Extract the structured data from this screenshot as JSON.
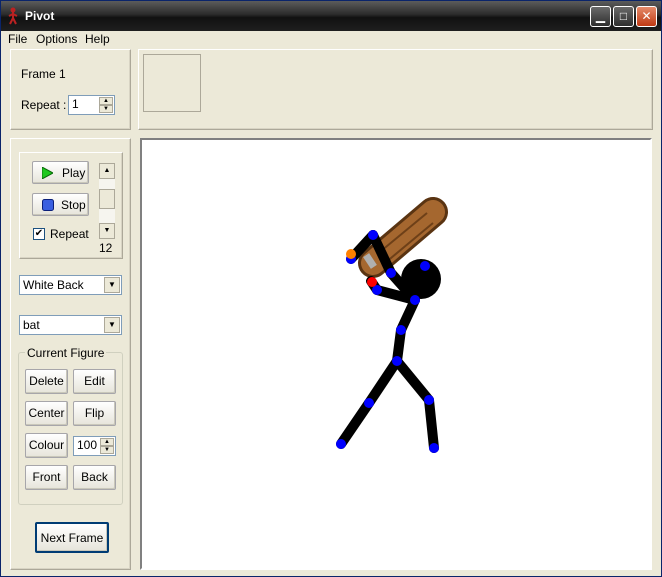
{
  "window": {
    "title": "Pivot",
    "minimize": "▁",
    "maximize": "□",
    "close": "✕"
  },
  "menu": {
    "file": "File",
    "options": "Options",
    "help": "Help"
  },
  "frame": {
    "label": "Frame 1",
    "repeat_label": "Repeat :",
    "repeat_value": "1"
  },
  "playback": {
    "play_label": "Play",
    "stop_label": "Stop",
    "repeat_label": "Repeat",
    "repeat_checked": "✔",
    "speed_value": "12"
  },
  "background_select": {
    "value": "White Back"
  },
  "figure_select": {
    "value": "bat"
  },
  "current_figure": {
    "group_label": "Current Figure",
    "delete_label": "Delete",
    "edit_label": "Edit",
    "center_label": "Center",
    "flip_label": "Flip",
    "colour_label": "Colour",
    "colour_value": "100",
    "front_label": "Front",
    "back_label": "Back"
  },
  "next_frame_label": "Next Frame",
  "colors": {
    "joint": "#0000ff",
    "root_joint": "#ff0000",
    "bat_handle_joint": "#ff8000",
    "limb": "#000000",
    "bat_wood": "#8b5a2b"
  }
}
